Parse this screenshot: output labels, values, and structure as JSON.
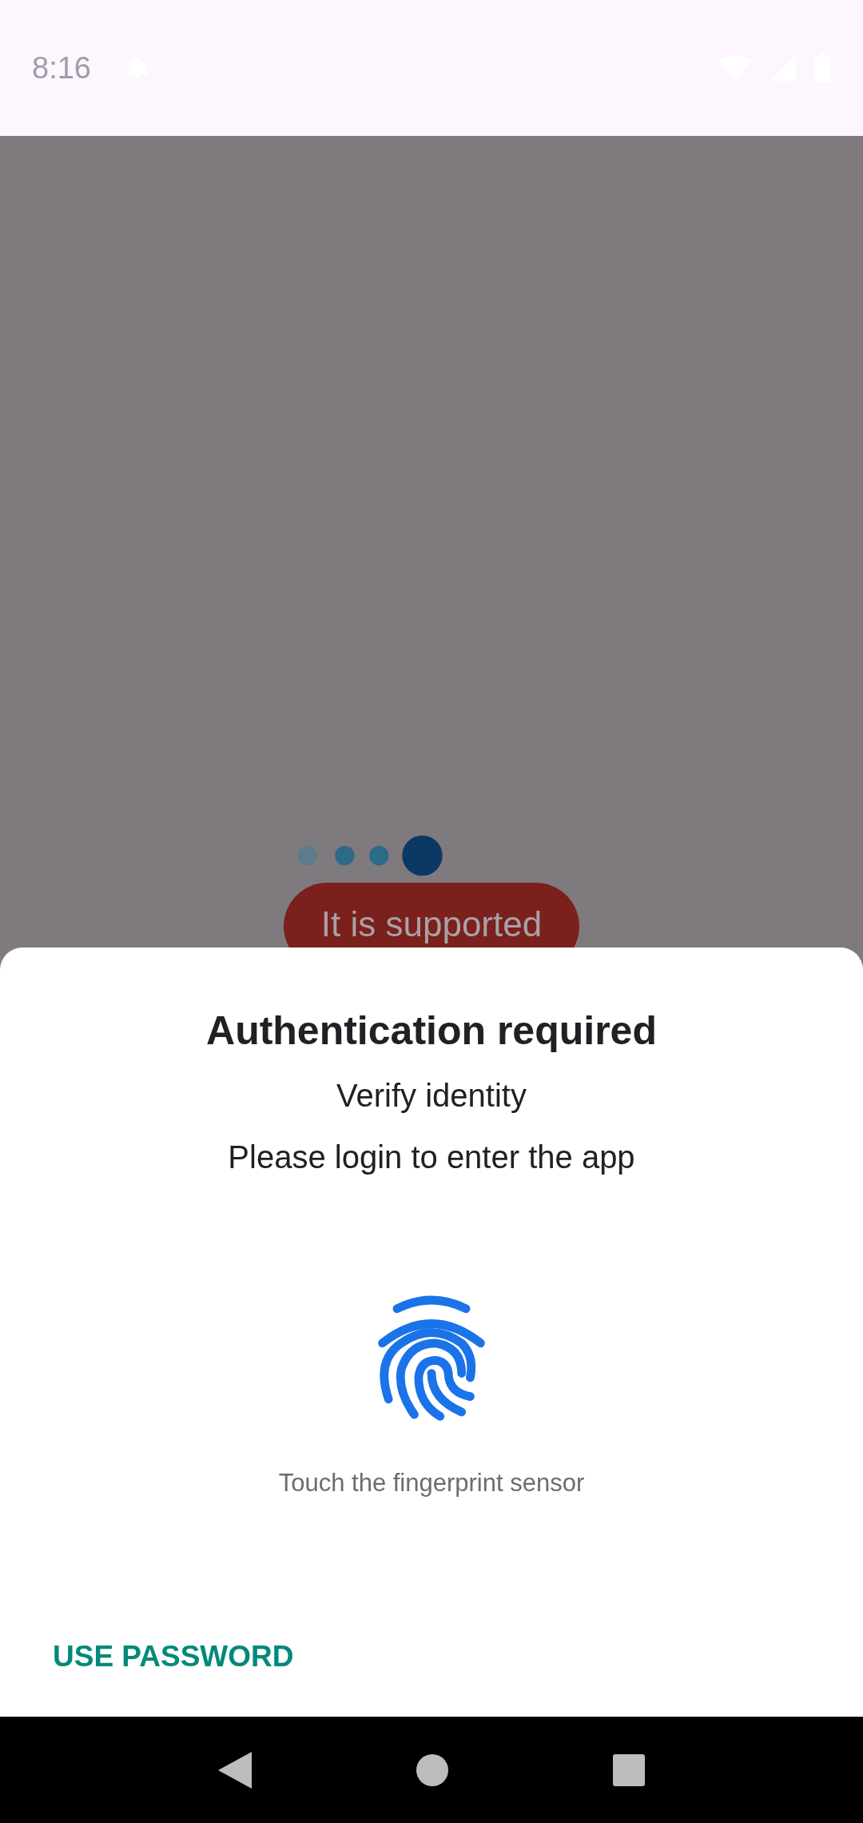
{
  "status_bar": {
    "time": "8:16"
  },
  "background": {
    "button": "It is supported"
  },
  "dialog": {
    "title": "Authentication required",
    "subtitle": "Verify identity",
    "description": "Please login to enter the app",
    "hint": "Touch the fingerprint sensor",
    "negative_button": "USE PASSWORD"
  }
}
